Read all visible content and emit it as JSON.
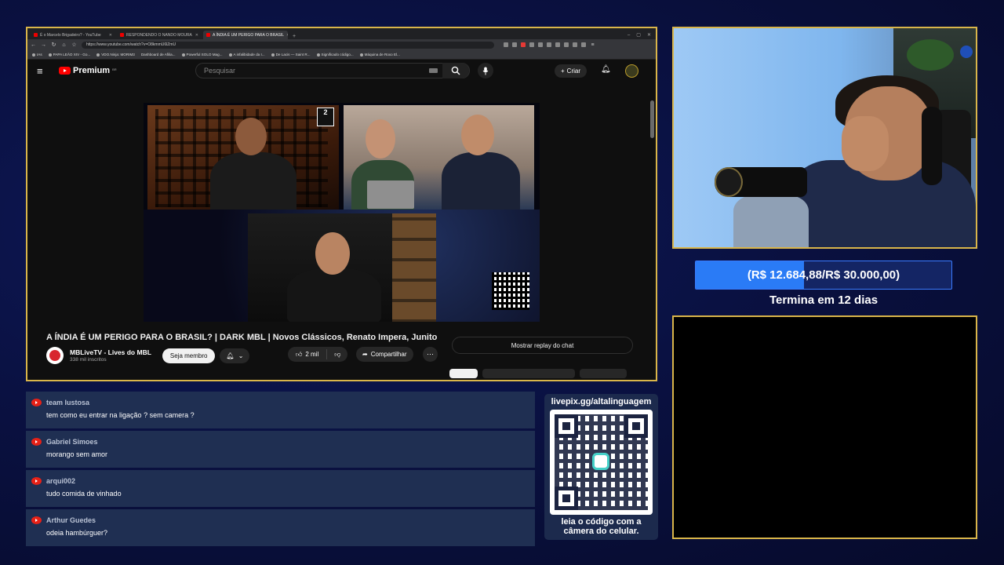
{
  "browser": {
    "tabs": [
      {
        "label": "É o Marcelo Brigadeiro? - YouTube",
        "active": false
      },
      {
        "label": "RESPONDENDO O NANDO MOURA",
        "active": false
      },
      {
        "label": "A ÍNDIA É UM PERIGO PARA O BRASIL",
        "active": true
      }
    ],
    "new_tab": "+",
    "url": "https://www.youtube.com/watch?v=O8kmmU6lZmU",
    "bookmarks": [
      "IAs",
      "PAPA LEÃO XIV - Go...",
      "VDO.Ninja: MORIM3",
      "Dashboard de Afilia...",
      "Powerful SOLO Mag...",
      "A infalibidade da I...",
      "De Lacis — Saint R...",
      "Significado código...",
      "Máquina de Roxo El..."
    ]
  },
  "youtube": {
    "brand": "Premium",
    "region": "BR",
    "search_placeholder": "Pesquisar",
    "create_label": "Criar",
    "video_badge": "2",
    "video_title": "A ÍNDIA É UM PERIGO PARA O BRASIL? | DARK MBL | Novos Clássicos, Renato Impera, Junito",
    "channel_name": "MBLiveTV - Lives do MBL",
    "subscribers": "338 mil inscritos",
    "join_label": "Seja membro",
    "likes": "2 mil",
    "share_label": "Compartilhar",
    "replay_label": "Mostrar replay do chat"
  },
  "goal": {
    "text": "(R$ 12.684,88/R$ 30.000,00)",
    "progress": 0.4228,
    "subtitle": "Termina em 12 dias"
  },
  "chat": {
    "messages": [
      {
        "user": "team lustosa",
        "text": "tem como eu entrar na ligação ? sem camera ?"
      },
      {
        "user": "Gabriel Simoes",
        "text": "morango sem amor"
      },
      {
        "user": "arqui002",
        "text": "tudo comida de vinhado"
      },
      {
        "user": "Arthur Guedes",
        "text": "odeia hambúrguer?"
      }
    ]
  },
  "livepix": {
    "url": "livepix.gg/altalinguagem",
    "caption_line1": "leia o código com a",
    "caption_line2": "câmera do celular."
  },
  "colors": {
    "frame_border": "#d9b54a",
    "goal_fill": "#2a7bf6",
    "chat_bg": "#1f2f52",
    "youtube_red": "#ff0000"
  }
}
